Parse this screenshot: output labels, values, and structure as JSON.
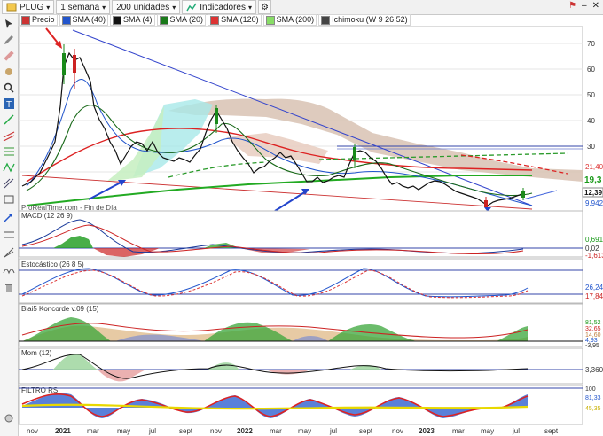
{
  "toolbar": {
    "ticker": "PLUG",
    "timeframe": "1 semana",
    "units": "200 unidades",
    "indicators": "Indicadores"
  },
  "legend": [
    {
      "label": "Precio",
      "color": "#cc3333"
    },
    {
      "label": "SMA (40)",
      "color": "#2255cc"
    },
    {
      "label": "SMA (4)",
      "color": "#111111"
    },
    {
      "label": "SMA (20)",
      "color": "#1a7a1a"
    },
    {
      "label": "SMA (120)",
      "color": "#dd3333"
    },
    {
      "label": "SMA (200)",
      "color": "#88dd66"
    },
    {
      "label": "Ichimoku (W 9 26 52)",
      "color": "#333333"
    }
  ],
  "watermark": "ProRealTime.com - Fin de Día",
  "panels": {
    "macd": {
      "title": "MACD (12 26 9)",
      "axis": [
        "0,691",
        "0,02",
        "-1,613"
      ]
    },
    "stoch": {
      "title": "Estocástico (26 8 5)",
      "axis": [
        "26,24",
        "17,84"
      ]
    },
    "koncorde": {
      "title": "Blai5 Koncorde v.09 (15)",
      "axis": [
        "81,52",
        "32,65",
        "14,60",
        "4,93",
        "-3,95"
      ]
    },
    "mom": {
      "title": "Mom (12)",
      "axis": [
        "3,360"
      ]
    },
    "rsi": {
      "title": "FILTRO RSI",
      "axis": [
        "100",
        "81,33",
        "45,35"
      ]
    }
  },
  "price_axis": {
    "ticks": [
      "70",
      "60",
      "50",
      "40",
      "30"
    ],
    "labels": [
      {
        "text": "21,40",
        "color": "#dd3333"
      },
      {
        "text": "19,3",
        "color": "#1a9a1a"
      },
      {
        "text": "12,39",
        "color": "#111111"
      },
      {
        "text": "9,942",
        "color": "#2255cc"
      }
    ]
  },
  "x_axis": {
    "labels": [
      "nov",
      "2021",
      "mar",
      "may",
      "jul",
      "sept",
      "nov",
      "2022",
      "mar",
      "may",
      "jul",
      "sept",
      "nov",
      "2023",
      "mar",
      "may",
      "jul",
      "sept"
    ],
    "bold": [
      "2021",
      "2022",
      "2023"
    ]
  },
  "chart_data": {
    "type": "candlestick",
    "symbol": "PLUG",
    "timeframe": "1 semana",
    "ylim": [
      0,
      75
    ],
    "price_ticks": [
      30,
      40,
      50,
      60,
      70
    ],
    "close_series_approx": [
      {
        "x": "2020-10",
        "close": 10
      },
      {
        "x": "2020-12",
        "close": 30
      },
      {
        "x": "2021-01",
        "close": 66
      },
      {
        "x": "2021-02",
        "close": 58
      },
      {
        "x": "2021-03",
        "close": 37
      },
      {
        "x": "2021-05",
        "close": 20
      },
      {
        "x": "2021-07",
        "close": 30
      },
      {
        "x": "2021-09",
        "close": 26
      },
      {
        "x": "2021-11",
        "close": 42
      },
      {
        "x": "2022-01",
        "close": 22
      },
      {
        "x": "2022-03",
        "close": 28
      },
      {
        "x": "2022-05",
        "close": 14
      },
      {
        "x": "2022-07",
        "close": 20
      },
      {
        "x": "2022-09",
        "close": 30
      },
      {
        "x": "2022-11",
        "close": 16
      },
      {
        "x": "2023-01",
        "close": 15
      },
      {
        "x": "2023-03",
        "close": 10
      },
      {
        "x": "2023-05",
        "close": 7
      },
      {
        "x": "2023-07",
        "close": 12.39
      }
    ],
    "last_values": {
      "SMA120": 21.4,
      "SMA200": 19.3,
      "close": 12.39,
      "SMA40": 9.942
    },
    "horizontal_levels": [
      30
    ]
  }
}
